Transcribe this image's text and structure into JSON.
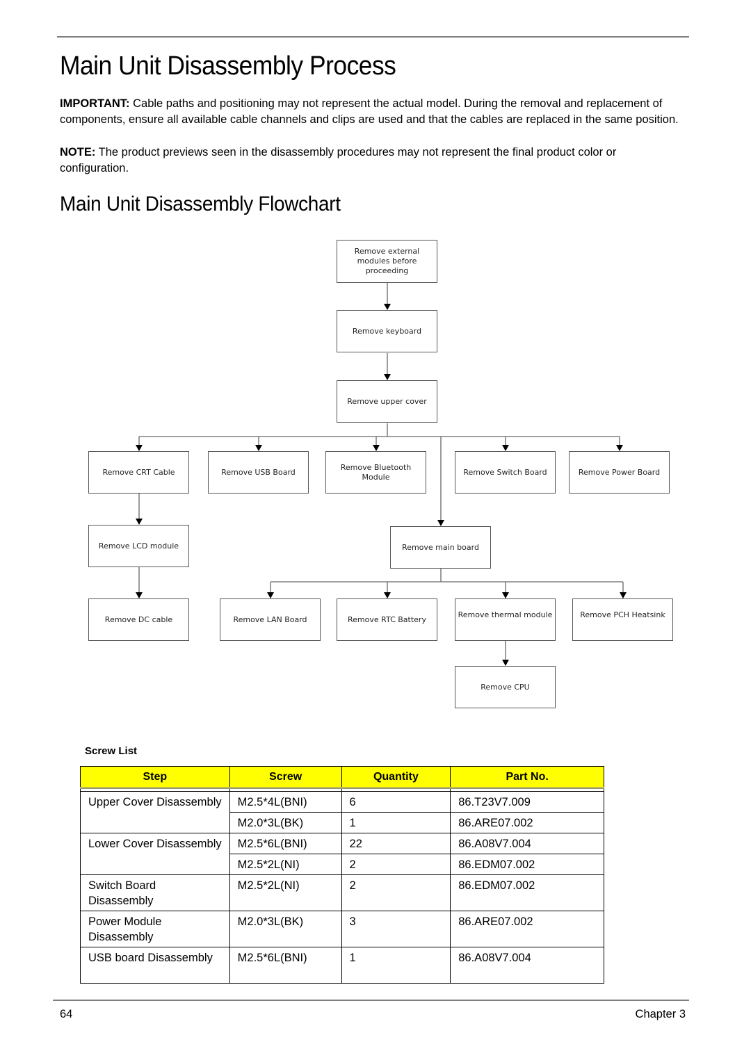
{
  "page": {
    "title": "Main Unit Disassembly Process",
    "important_label": "IMPORTANT:",
    "important_text": " Cable paths and positioning may not represent the actual model. During the removal and replacement of components, ensure all available cable channels and clips are used and that the cables are replaced in the same position.",
    "note_label": "NOTE:",
    "note_text": " The product previews seen in the disassembly procedures may not represent the final product color or configuration.",
    "flowchart_title": "Main Unit Disassembly Flowchart"
  },
  "flowchart": {
    "nodes": [
      {
        "id": "external",
        "label": "Remove external modules before proceeding"
      },
      {
        "id": "keyboard",
        "label": "Remove keyboard"
      },
      {
        "id": "upper-cover",
        "label": "Remove upper cover"
      },
      {
        "id": "crt-cable",
        "label": "Remove CRT Cable"
      },
      {
        "id": "usb-board",
        "label": "Remove USB Board"
      },
      {
        "id": "bluetooth",
        "label": "Remove Bluetooth Module"
      },
      {
        "id": "switch-board",
        "label": "Remove Switch Board"
      },
      {
        "id": "power-board",
        "label": "Remove Power Board"
      },
      {
        "id": "lcd-module",
        "label": "Remove LCD module"
      },
      {
        "id": "main-board",
        "label": "Remove main board"
      },
      {
        "id": "dc-cable",
        "label": "Remove DC cable"
      },
      {
        "id": "lan-board",
        "label": "Remove LAN Board"
      },
      {
        "id": "rtc-battery",
        "label": "Remove RTC Battery"
      },
      {
        "id": "thermal",
        "label": "Remove thermal module"
      },
      {
        "id": "pch-heatsink",
        "label": "Remove PCH Heatsink"
      },
      {
        "id": "cpu",
        "label": "Remove CPU"
      }
    ],
    "edges": [
      [
        "external",
        "keyboard"
      ],
      [
        "keyboard",
        "upper-cover"
      ],
      [
        "upper-cover",
        "crt-cable"
      ],
      [
        "upper-cover",
        "usb-board"
      ],
      [
        "upper-cover",
        "bluetooth"
      ],
      [
        "upper-cover",
        "switch-board"
      ],
      [
        "upper-cover",
        "power-board"
      ],
      [
        "upper-cover",
        "main-board"
      ],
      [
        "crt-cable",
        "lcd-module"
      ],
      [
        "lcd-module",
        "dc-cable"
      ],
      [
        "main-board",
        "lan-board"
      ],
      [
        "main-board",
        "rtc-battery"
      ],
      [
        "main-board",
        "thermal"
      ],
      [
        "main-board",
        "pch-heatsink"
      ],
      [
        "thermal",
        "cpu"
      ]
    ]
  },
  "screw_list": {
    "title": "Screw List",
    "headers": [
      "Step",
      "Screw",
      "Quantity",
      "Part No."
    ],
    "groups": [
      {
        "step": "Upper Cover Disassembly",
        "rows": [
          {
            "screw": "M2.5*4L(BNI)",
            "quantity": "6",
            "part_no": "86.T23V7.009"
          },
          {
            "screw": "M2.0*3L(BK)",
            "quantity": "1",
            "part_no": "86.ARE07.002"
          }
        ]
      },
      {
        "step": "Lower Cover Disassembly",
        "rows": [
          {
            "screw": "M2.5*6L(BNI)",
            "quantity": "22",
            "part_no": "86.A08V7.004"
          },
          {
            "screw": "M2.5*2L(NI)",
            "quantity": "2",
            "part_no": "86.EDM07.002"
          }
        ]
      },
      {
        "step": "Switch Board Disassembly",
        "rows": [
          {
            "screw": "M2.5*2L(NI)",
            "quantity": "2",
            "part_no": "86.EDM07.002"
          }
        ]
      },
      {
        "step": "Power Module Disassembly",
        "rows": [
          {
            "screw": "M2.0*3L(BK)",
            "quantity": "3",
            "part_no": "86.ARE07.002"
          }
        ]
      },
      {
        "step": "USB board Disassembly",
        "rows": [
          {
            "screw": "M2.5*6L(BNI)",
            "quantity": "1",
            "part_no": "86.A08V7.004"
          }
        ]
      }
    ]
  },
  "footer": {
    "page_number": "64",
    "chapter": "Chapter 3"
  }
}
